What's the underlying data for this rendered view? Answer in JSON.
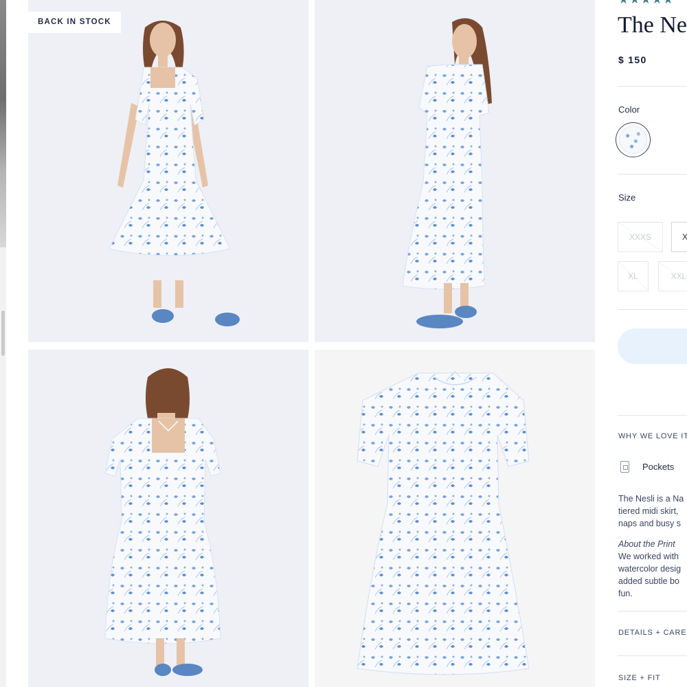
{
  "badge": "BACK IN STOCK",
  "product": {
    "title": "The Nesli",
    "price": "$ 150",
    "rating_stars": "★★★★★"
  },
  "color": {
    "label": "Color"
  },
  "size": {
    "label": "Size",
    "options": [
      "XXXS",
      "X",
      "XL",
      "XXL"
    ]
  },
  "why_we_love_it": {
    "heading": "WHY WE LOVE IT",
    "feature": "Pockets",
    "description_lines": [
      "The Nesli is a Na",
      "tiered midi skirt,",
      "naps and busy s"
    ],
    "about_print_heading": "About the Print",
    "about_print_lines": [
      "We worked with",
      "watercolor desig",
      "added subtle bo",
      "fun."
    ]
  },
  "sections": {
    "details": "DETAILS + CARE",
    "size_fit": "SIZE + FIT"
  },
  "colors": {
    "accent": "#3f7d8c",
    "text_dark": "#141b33",
    "button_bg": "#e8f2fd",
    "print_blue": "#5d8fd1",
    "shoe_blue": "#5a86c2"
  }
}
